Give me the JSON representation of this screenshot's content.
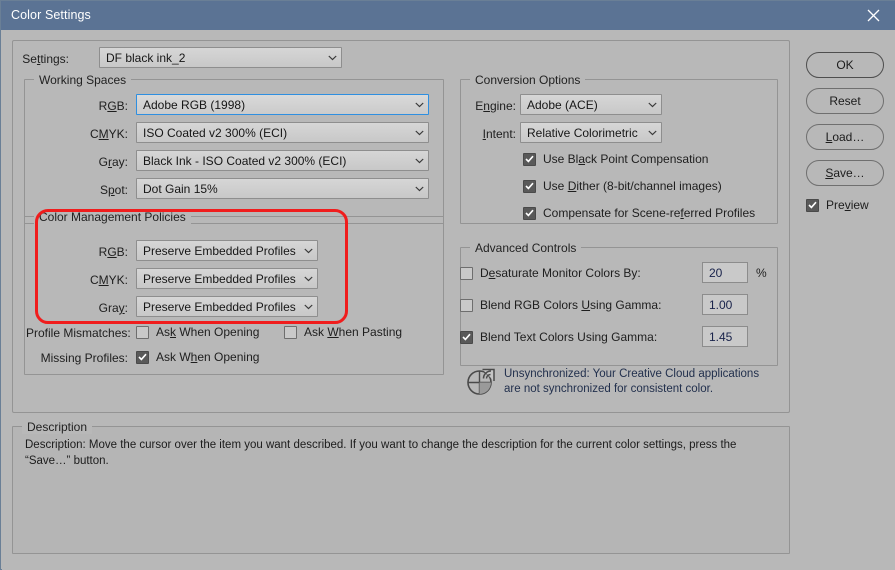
{
  "window": {
    "title": "Color Settings",
    "close_icon": "close-icon"
  },
  "settings_row": {
    "label": "Settings:",
    "value": "DF black ink_2"
  },
  "working_spaces": {
    "legend": "Working Spaces",
    "rows": [
      {
        "label_pre": "R",
        "label_key": "G",
        "label_post": "B:",
        "label_full": "RGB:",
        "value": "Adobe RGB (1998)"
      },
      {
        "label_pre": "C",
        "label_key": "M",
        "label_post": "YK:",
        "label_full": "CMYK:",
        "value": "ISO Coated v2 300% (ECI)"
      },
      {
        "label_pre": "G",
        "label_key": "r",
        "label_post": "ay:",
        "label_full": "Gray:",
        "value": "Black Ink - ISO Coated v2 300% (ECI)"
      },
      {
        "label_pre": "S",
        "label_key": "p",
        "label_post": "ot:",
        "label_full": "Spot:",
        "value": "Dot Gain 15%"
      }
    ]
  },
  "color_management_policies": {
    "legend": "Color Management Policies",
    "rows": [
      {
        "label_full": "RGB:",
        "value": "Preserve Embedded Profiles"
      },
      {
        "label_full": "CMYK:",
        "value": "Preserve Embedded Profiles"
      },
      {
        "label_full": "Gray:",
        "value": "Preserve Embedded Profiles"
      }
    ],
    "profile_mismatches_label": "Profile Mismatches:",
    "missing_profiles_label": "Missing Profiles:",
    "ask_when_opening_mismatch": {
      "label": "Ask When Opening",
      "checked": false
    },
    "ask_when_pasting": {
      "label": "Ask When Pasting",
      "checked": false
    },
    "ask_when_opening_missing": {
      "label": "Ask When Opening",
      "checked": true
    },
    "highlight_color": "#f01d1d"
  },
  "conversion_options": {
    "legend": "Conversion Options",
    "engine_label": "Engine:",
    "engine_value": "Adobe (ACE)",
    "intent_label": "Intent:",
    "intent_value": "Relative Colorimetric",
    "checkboxes": [
      {
        "label": "Use Black Point Compensation",
        "checked": true
      },
      {
        "label": "Use Dither (8-bit/channel images)",
        "checked": true
      },
      {
        "label": "Compensate for Scene-referred Profiles",
        "checked": true
      }
    ]
  },
  "advanced_controls": {
    "legend": "Advanced Controls",
    "rows": [
      {
        "label": "Desaturate Monitor Colors By:",
        "checked": false,
        "value": "20",
        "suffix": "%"
      },
      {
        "label": "Blend RGB Colors Using Gamma:",
        "checked": false,
        "value": "1.00",
        "suffix": ""
      },
      {
        "label": "Blend Text Colors Using Gamma:",
        "checked": true,
        "value": "1.45",
        "suffix": ""
      }
    ]
  },
  "sync_notice": {
    "icon": "creative-cloud-sync-icon",
    "text": "Unsynchronized: Your Creative Cloud applications\nare not synchronized for consistent color."
  },
  "description": {
    "legend": "Description",
    "text": "Description:  Move the cursor over the item you want described.  If you want to change the description for the current color settings, press the “Save…” button."
  },
  "buttons": {
    "ok": "OK",
    "reset": "Reset",
    "load": "Load…",
    "save": "Save…",
    "preview": {
      "label": "Preview",
      "checked": true
    }
  }
}
